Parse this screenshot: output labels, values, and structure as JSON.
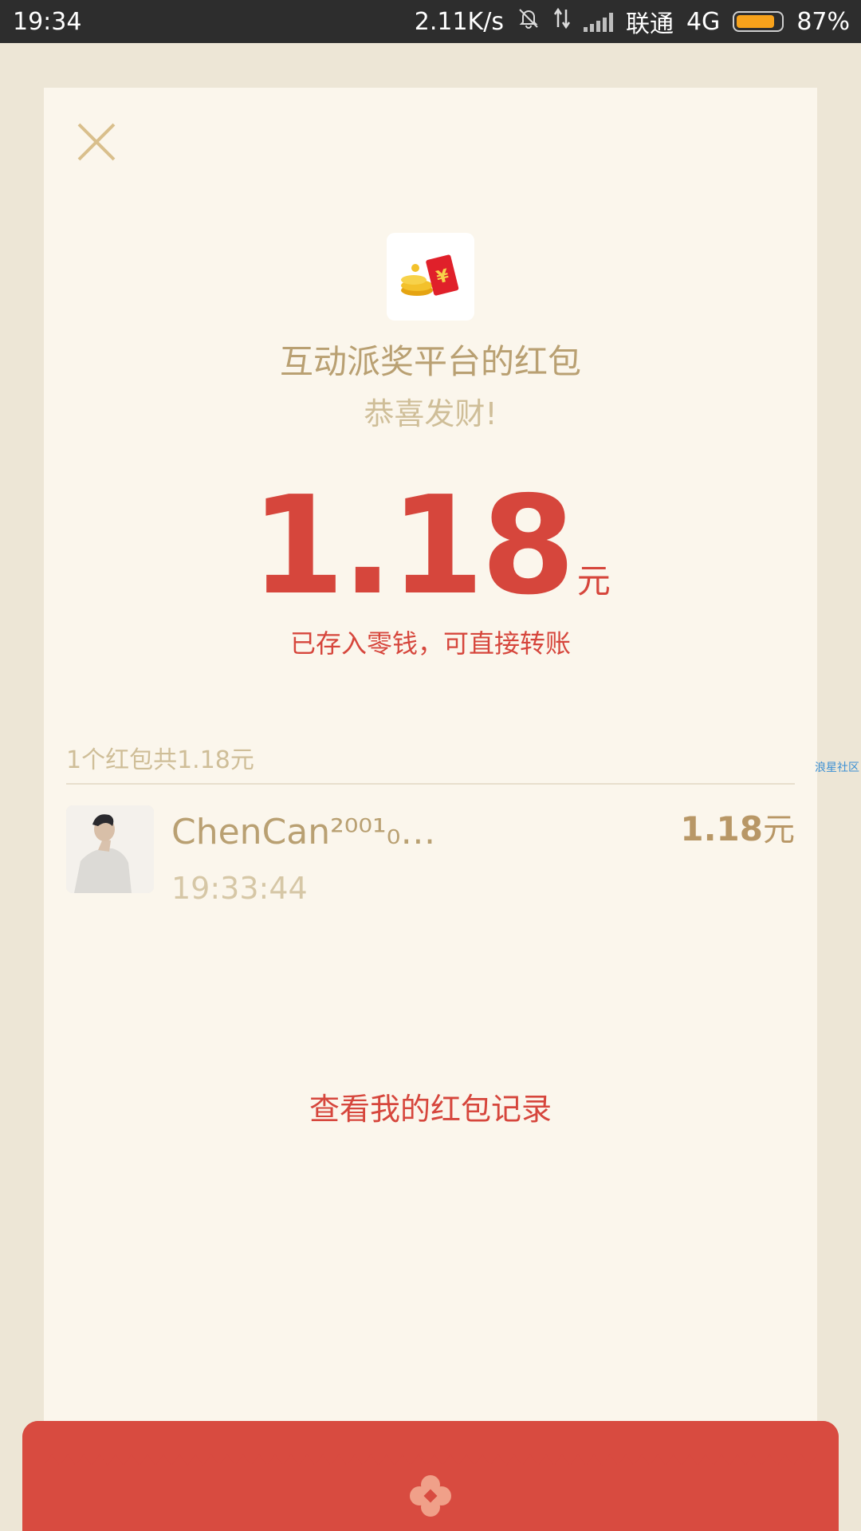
{
  "status_bar": {
    "time": "19:34",
    "net_speed": "2.11K/s",
    "carrier": "联通",
    "network": "4G",
    "battery_percent": "87%",
    "battery_level": 0.87,
    "icons": [
      "bell-muted-icon",
      "data-transfer-icon",
      "signal-icon",
      "battery-icon"
    ]
  },
  "card": {
    "close_icon": "close-icon",
    "logo_icon": "red-envelope-coins-icon",
    "sender_title": "互动派奖平台的红包",
    "wish": "恭喜发财!",
    "amount": "1.18",
    "amount_unit": "元",
    "stored_note": "已存入零钱，可直接转账",
    "summary": "1个红包共1.18元",
    "receivers": [
      {
        "name": "ChenCan²⁰⁰¹₀…",
        "time": "19:33:44",
        "amount": "1.18",
        "unit": "元"
      }
    ],
    "records_link": "查看我的红包记录"
  },
  "watermark": "浪星社区",
  "colors": {
    "accent_red": "#d6463c",
    "gold_text": "#b9a072",
    "muted_text": "#cfbe98",
    "card_bg": "#fbf6ec",
    "page_bg": "#ede6d6",
    "envelope_red": "#d84b40"
  }
}
